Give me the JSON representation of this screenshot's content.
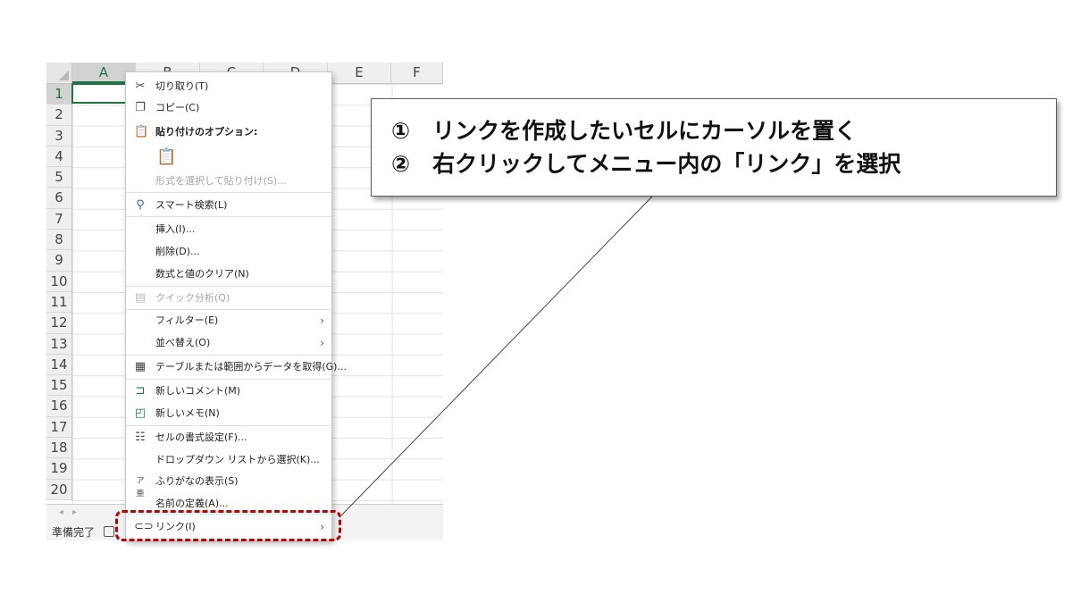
{
  "spreadsheet": {
    "columns": [
      "A",
      "B",
      "C",
      "D",
      "E",
      "F"
    ],
    "rows": [
      "1",
      "2",
      "3",
      "4",
      "5",
      "6",
      "7",
      "8",
      "9",
      "10",
      "11",
      "12",
      "13",
      "14",
      "15",
      "16",
      "17",
      "18",
      "19",
      "20"
    ],
    "status": "準備完了"
  },
  "context_menu": {
    "cut": "切り取り(T)",
    "copy": "コピー(C)",
    "paste_options": "貼り付けのオプション:",
    "paste_special": "形式を選択して貼り付け(S)...",
    "smart_lookup": "スマート検索(L)",
    "insert": "挿入(I)...",
    "delete": "削除(D)...",
    "clear_contents": "数式と値のクリア(N)",
    "quick_analysis": "クイック分析(Q)",
    "filter": "フィルター(E)",
    "sort": "並べ替え(O)",
    "get_data": "テーブルまたは範囲からデータを取得(G)...",
    "new_comment": "新しいコメント(M)",
    "new_note": "新しいメモ(N)",
    "format_cells": "セルの書式設定(F)...",
    "pick_dropdown": "ドロップダウン リストから選択(K)...",
    "phonetic": "ふりがなの表示(S)",
    "define_name": "名前の定義(A)...",
    "link": "リンク(I)",
    "arrow": "›"
  },
  "callout": {
    "line1": "①　リンクを作成したいセルにカーソルを置く",
    "line2": "②　右クリックしてメニュー内の「リンク」を選択"
  },
  "colors": {
    "highlight": "#c00000",
    "excel_green": "#217346"
  },
  "icons": {
    "cut": "scissors-icon",
    "copy": "copy-icon",
    "paste": "clipboard-icon",
    "smart_lookup": "search-icon",
    "quick_analysis": "quick-analysis-icon",
    "get_data": "table-icon",
    "new_comment": "comment-icon",
    "new_note": "note-icon",
    "format_cells": "format-cells-icon",
    "phonetic": "phonetic-icon",
    "link": "link-icon"
  }
}
